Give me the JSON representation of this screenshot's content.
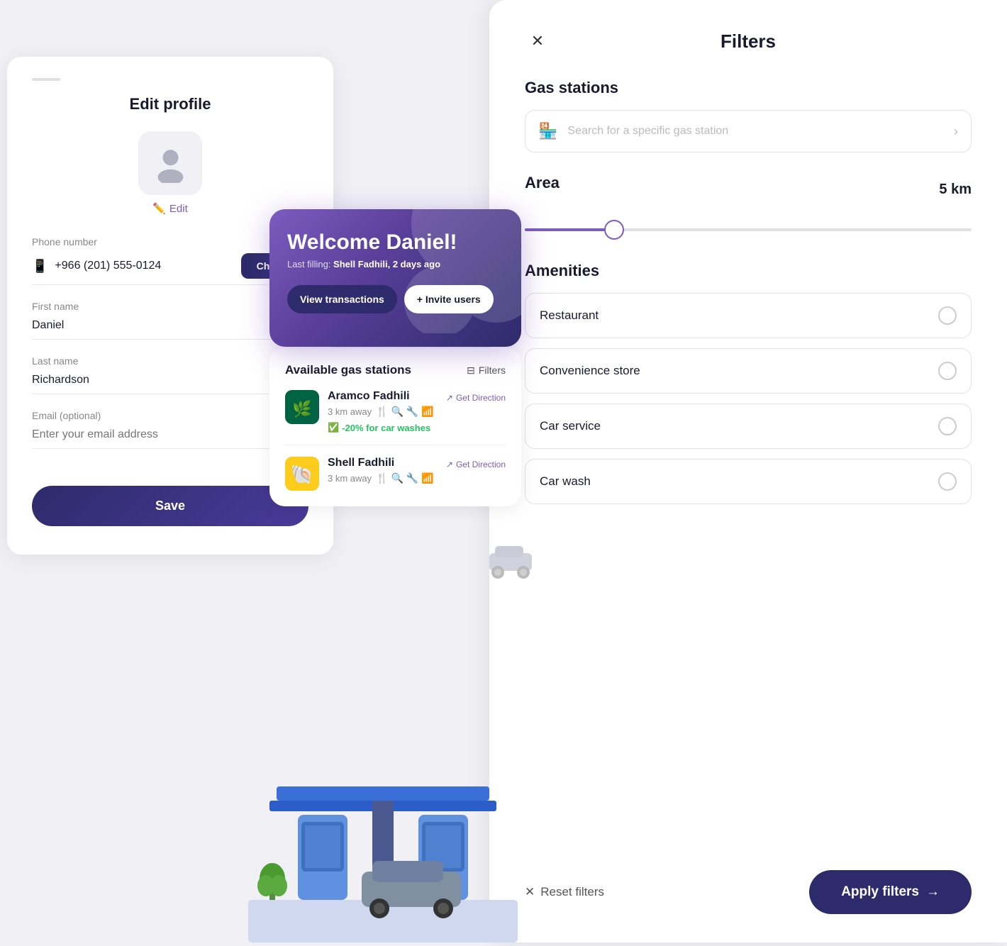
{
  "editProfile": {
    "title": "Edit profile",
    "avatar": "user-avatar",
    "editLabel": "Edit",
    "fields": {
      "phoneNumber": {
        "label": "Phone number",
        "value": "+966 (201) 555-0124",
        "changeBtnLabel": "Change"
      },
      "firstName": {
        "label": "First name",
        "value": "Daniel"
      },
      "lastName": {
        "label": "Last name",
        "value": "Richardson"
      },
      "email": {
        "label": "Email (optional)",
        "placeholder": "Enter your email address"
      }
    },
    "saveLabel": "Save"
  },
  "filters": {
    "title": "Filters",
    "gasStationsSection": "Gas stations",
    "searchPlaceholder": "Search for a specific gas station",
    "areaSection": "Area",
    "distanceValue": "5 km",
    "amenitiesSection": "Amenities",
    "amenities": [
      {
        "label": "Restaurant",
        "checked": false
      },
      {
        "label": "Convenience store",
        "checked": false
      },
      {
        "label": "Car service",
        "checked": false
      },
      {
        "label": "Car wash",
        "checked": false
      }
    ],
    "resetLabel": "Reset filters",
    "applyLabel": "Apply filters"
  },
  "welcomeCard": {
    "title": "Welcome Daniel!",
    "subtitle": "Last filling: Shell Fadhili, 2 days ago",
    "viewTransactions": "View transactions",
    "inviteUsers": "+ Invite users"
  },
  "gasStations": {
    "title": "Available gas stations",
    "filtersLabel": "Filters",
    "stations": [
      {
        "name": "Aramco Fadhili",
        "distance": "3 km away",
        "discount": "-20% for car washes",
        "getDirection": "Get Direction",
        "logo": "aramco"
      },
      {
        "name": "Shell Fadhili",
        "distance": "3 km away",
        "getDirection": "Get Direction",
        "logo": "shell"
      }
    ]
  }
}
